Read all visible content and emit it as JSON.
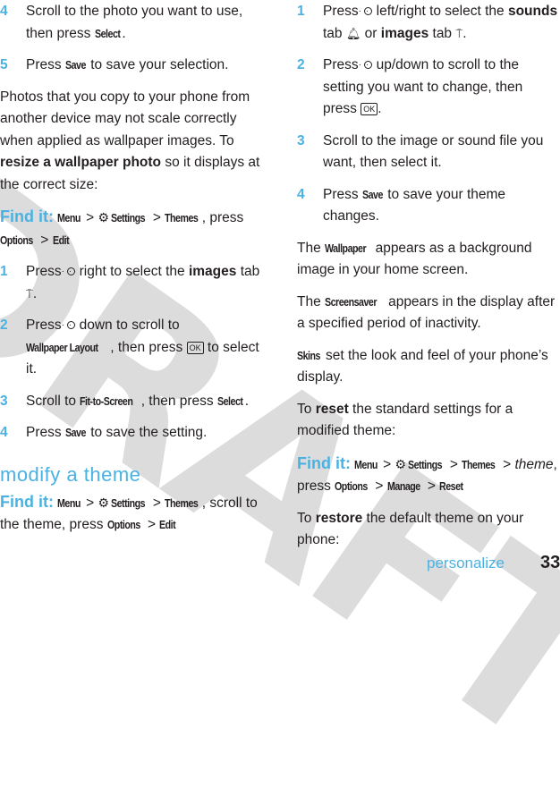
{
  "watermark": "DRAFT",
  "left_column": {
    "steps_top": [
      {
        "num": "4",
        "pre": "Scroll to the photo you want to use, then press ",
        "key": "Select",
        "post": "."
      },
      {
        "num": "5",
        "pre": "Press ",
        "key": "Save",
        "post": " to save your selection."
      }
    ],
    "intro": {
      "text1": "Photos that you copy to your phone from another device may not scale correctly when applied as wallpaper images. To ",
      "bold": "resize a wallpaper photo",
      "text2": " so it displays at the correct size:"
    },
    "findit1": {
      "label": "Find it:",
      "menu": "Menu",
      "settings": "Settings",
      "themes": "Themes",
      "mid": ", press ",
      "options": "Options",
      "edit": "Edit"
    },
    "steps": [
      {
        "num": "1",
        "pre": "Press",
        "mid": "right to select the ",
        "bold": "images",
        "post": " tab",
        "end": "."
      },
      {
        "num": "2",
        "pre": "Press",
        "mid": "down to scroll to ",
        "key": "Wallpaper Layout",
        "mid2": ", then press ",
        "ok": "OK",
        "post": " to select it."
      },
      {
        "num": "3",
        "pre": "Scroll to ",
        "key": "Fit-to-Screen",
        "mid": ", then press ",
        "key2": "Select",
        "post": "."
      },
      {
        "num": "4",
        "pre": "Press ",
        "key": "Save",
        "post": " to save the setting."
      }
    ],
    "section_title": "modify a theme",
    "findit2": {
      "label": "Find it:",
      "menu": "Menu",
      "settings": "Settings",
      "themes": "Themes",
      "mid": ", scroll to the theme, press ",
      "options": "Options",
      "edit": "Edit"
    }
  },
  "right_column": {
    "steps": [
      {
        "num": "1",
        "pre": "Press",
        "mid": "left/right to select the ",
        "bold1": "sounds",
        "mid2": " tab ",
        "mid3": " or ",
        "bold2": "images",
        "mid4": " tab ",
        "end": "."
      },
      {
        "num": "2",
        "pre": "Press",
        "mid": "up/down to scroll to the setting you want to change, then press ",
        "ok": "OK",
        "end": "."
      },
      {
        "num": "3",
        "text": "Scroll to the image or sound file you want, then select it."
      },
      {
        "num": "4",
        "pre": "Press ",
        "key": "Save",
        "post": " to save your theme changes."
      }
    ],
    "wallpaper": {
      "pre": "The ",
      "key": "Wallpaper",
      "post": " appears as a background image in your home screen."
    },
    "screensaver": {
      "pre": "The ",
      "key": "Screensaver",
      "post": " appears in the display after a specified period of inactivity."
    },
    "skins": {
      "key": "Skins",
      "post": " set the look and feel of your phone’s display."
    },
    "reset": {
      "pre": "To ",
      "bold": "reset",
      "post": " the standard settings for a modified theme:"
    },
    "findit": {
      "label": "Find it:",
      "menu": "Menu",
      "settings": "Settings",
      "themes": "Themes",
      "theme_italic": "theme",
      "press": ", press ",
      "options": "Options",
      "manage": "Manage",
      "reset": "Reset"
    },
    "restore": {
      "pre": "To ",
      "bold": "restore",
      "post": " the default theme on your phone:"
    }
  },
  "footer": {
    "section": "personalize",
    "page_number": "33"
  },
  "icons": {
    "nav_key": "navigation-key-icon",
    "ok_key": "ok-key-icon",
    "settings": "settings-gear-icon",
    "sounds_tab": "bell-icon",
    "images_tab": "paint-roller-icon"
  },
  "colors": {
    "accent": "#4ab2e3",
    "text": "#231f20",
    "watermark": "#dcdcdd"
  }
}
